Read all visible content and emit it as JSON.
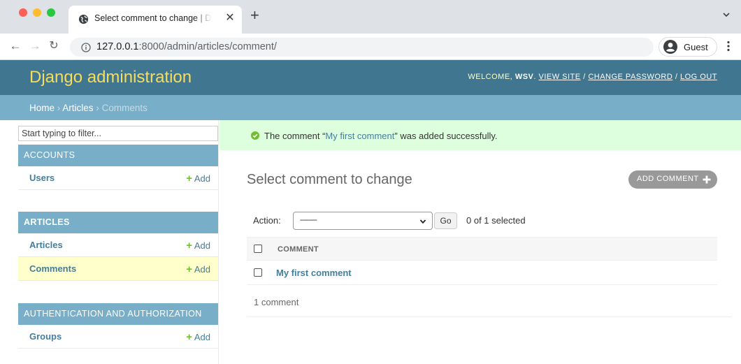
{
  "browser": {
    "tab_title": "Select comment to change | Django site admin",
    "url_host": "127.0.0.1",
    "url_path": ":8000/admin/articles/comment/",
    "profile_label": "Guest"
  },
  "header": {
    "branding": "Django administration",
    "welcome": "WELCOME,",
    "username": "WSV",
    "view_site": "VIEW SITE",
    "change_password": "CHANGE PASSWORD",
    "log_out": "LOG OUT",
    "sep": "/"
  },
  "breadcrumbs": {
    "home": "Home",
    "app": "Articles",
    "current": "Comments",
    "sep": "›"
  },
  "sidebar": {
    "filter_placeholder": "Start typing to filter...",
    "modules": [
      {
        "caption": "ACCOUNTS",
        "models": [
          {
            "name": "Users",
            "add": "Add"
          }
        ]
      },
      {
        "caption": "ARTICLES",
        "models": [
          {
            "name": "Articles",
            "add": "Add"
          },
          {
            "name": "Comments",
            "add": "Add"
          }
        ]
      },
      {
        "caption": "AUTHENTICATION AND AUTHORIZATION",
        "models": [
          {
            "name": "Groups",
            "add": "Add"
          }
        ]
      }
    ]
  },
  "message": {
    "prefix": "The comment “",
    "link": "My first comment",
    "suffix": "” was added successfully."
  },
  "main": {
    "title": "Select comment to change",
    "add_button": "ADD COMMENT",
    "action_label": "Action:",
    "action_selected": "---------",
    "go_label": "Go",
    "counter": "0 of 1 selected",
    "column_header": "COMMENT",
    "rows": [
      {
        "title": "My first comment"
      }
    ],
    "result_count": "1 comment"
  },
  "colors": {
    "header_bg": "#417690",
    "branding": "#f5dd5d",
    "module_bg": "#79aec8",
    "link": "#447e9b",
    "success_bg": "#dddddd",
    "add_plus": "#70bf2b"
  }
}
